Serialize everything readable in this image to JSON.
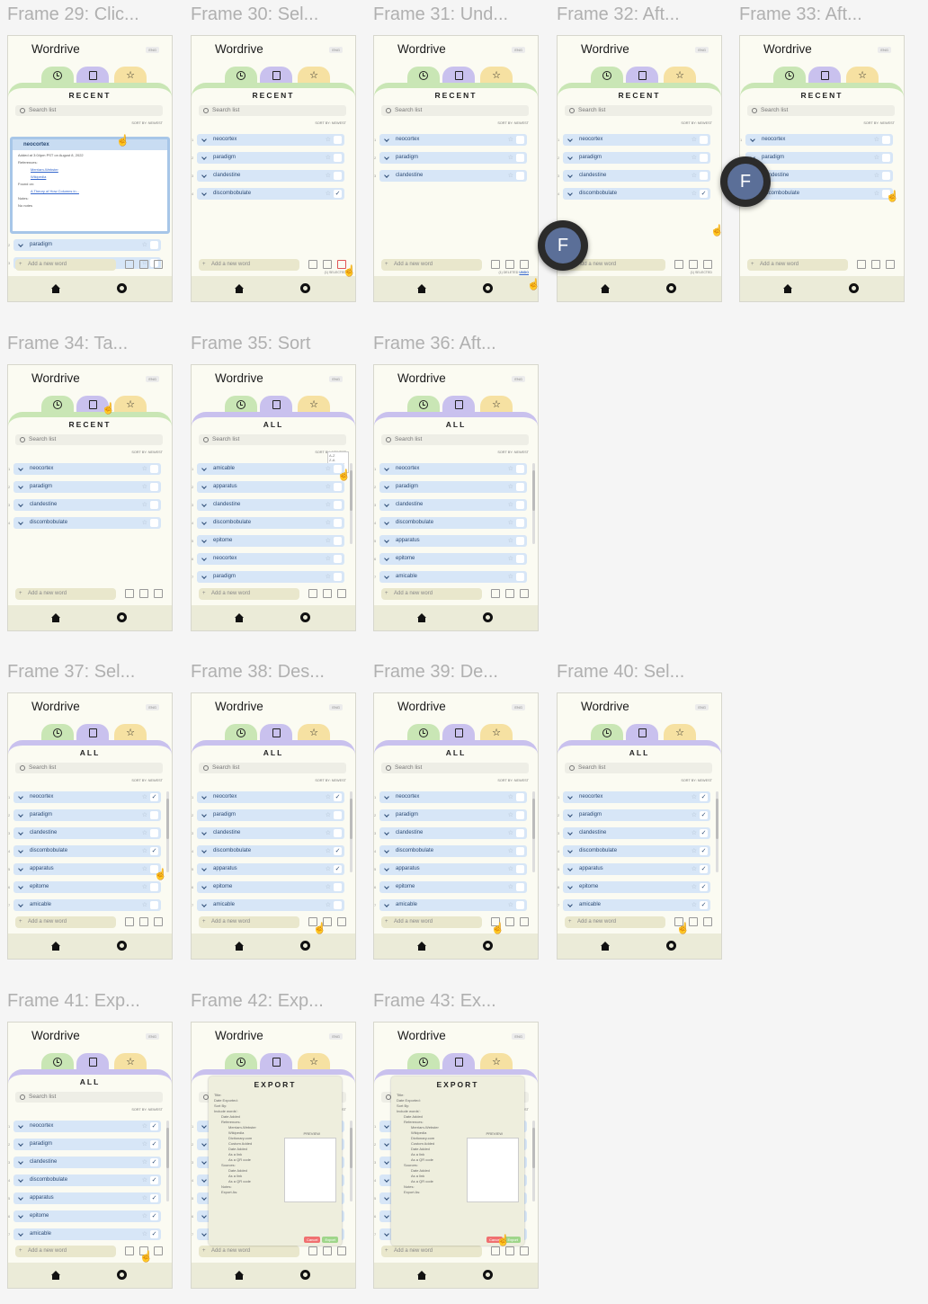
{
  "app": {
    "title": "Wordrive",
    "lang": "ENG",
    "search_placeholder": "Search list",
    "add_placeholder": "Add a new word",
    "sort_label": "SORT BY:",
    "sort_value": "NEWEST",
    "recent_title": "RECENT",
    "all_title": "ALL",
    "export_title": "EXPORT"
  },
  "words_recent": [
    "neocortex",
    "paradigm",
    "clandestine",
    "discombobulate"
  ],
  "words_all": [
    "neocortex",
    "paradigm",
    "clandestine",
    "discombobulate",
    "apparatus",
    "epitome",
    "amicable"
  ],
  "words_sorted": [
    "amicable",
    "apparatus",
    "clandestine",
    "discombobulate",
    "epitome",
    "neocortex",
    "paradigm"
  ],
  "frames": [
    {
      "label": "Frame 29: Clic...",
      "view": "recent",
      "variant": "expanded"
    },
    {
      "label": "Frame 30: Sel...",
      "view": "recent",
      "variant": "select-delete",
      "status": "(1) SELECTED"
    },
    {
      "label": "Frame 31: Und...",
      "view": "recent",
      "variant": "deleted",
      "status_prefix": "(1) DELETED",
      "status_undo": "UNDO"
    },
    {
      "label": "Frame 32: Aft...",
      "view": "recent",
      "variant": "after-undo",
      "status": "(1) SELECTED"
    },
    {
      "label": "Frame 33: Aft...",
      "view": "recent",
      "variant": "after"
    },
    {
      "label": "Frame 34: Ta...",
      "view": "recent",
      "variant": "plain"
    },
    {
      "label": "Frame 35: Sort",
      "view": "all",
      "variant": "sort"
    },
    {
      "label": "Frame 36: Aft...",
      "view": "all",
      "variant": "plain"
    },
    {
      "label": "Frame 37: Sel...",
      "view": "all",
      "variant": "some-checked"
    },
    {
      "label": "Frame 38: Des...",
      "view": "all",
      "variant": "some-checked"
    },
    {
      "label": "Frame 39: De...",
      "view": "all",
      "variant": "plain"
    },
    {
      "label": "Frame 40: Sel...",
      "view": "all",
      "variant": "all-checked"
    },
    {
      "label": "Frame 41: Exp...",
      "view": "all",
      "variant": "all-checked"
    },
    {
      "label": "Frame 42: Exp...",
      "view": "all",
      "variant": "export"
    },
    {
      "label": "Frame 43: Ex...",
      "view": "all",
      "variant": "export"
    }
  ],
  "expanded_card": {
    "word": "neocortex",
    "added": "Added at 3:04pm PST on August 8, 2022",
    "references_label": "References:",
    "ref1": "Merriam-Webster",
    "ref2": "Wikipedia",
    "found_label": "Found on:",
    "found": "A Theory of How Columns in...",
    "notes_label": "Notes:",
    "notes": "No notes"
  },
  "sort_options": [
    "A-Z",
    "Z-A",
    "NEWEST",
    "OLDEST"
  ],
  "export": {
    "title_label": "Title:",
    "date_label": "Date Exported:",
    "sort_label": "Sort By:",
    "include_label": "Include words':",
    "date_added": "Date Added",
    "references": "References:",
    "refs": [
      "Merriam-Webster",
      "Wikipedia",
      "Dictionary.com",
      "Custom Added"
    ],
    "ref_opts": [
      "Date Added",
      "As a link",
      "As a QR code"
    ],
    "sources": "Sources:",
    "notes": "Notes:",
    "export_as": "Export As:",
    "preview": "PREVIEW",
    "cancel": "Cancel",
    "export": "Export"
  },
  "avatar_letter": "F"
}
